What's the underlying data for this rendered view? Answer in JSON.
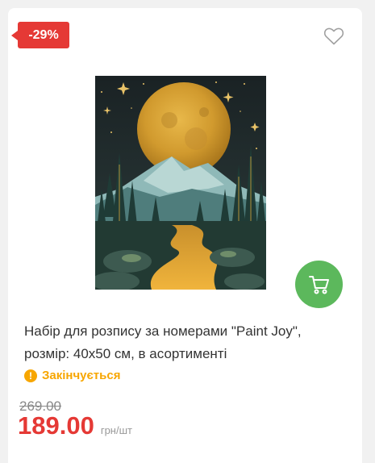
{
  "card": {
    "discount_badge": "-29%",
    "title": "Набір для розпису за номерами \"Paint Joy\", розмір: 40х50 см, в асортименті",
    "stock_icon": "!",
    "stock_status": "Закінчується",
    "old_price": "269.00",
    "price": "189.00",
    "unit": "грн/шт"
  },
  "icons": {
    "wishlist": "heart-icon",
    "cart": "cart-icon",
    "stock": "exclamation-icon"
  },
  "colors": {
    "discount": "#e53935",
    "price": "#e53935",
    "cart_button": "#5cb85c",
    "stock": "#f7a600"
  }
}
